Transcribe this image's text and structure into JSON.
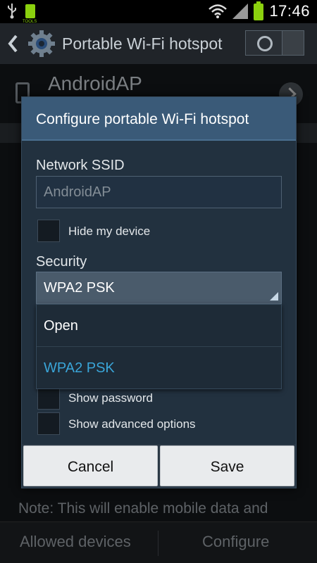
{
  "status_bar": {
    "time": "17:46",
    "icons": [
      "usb-icon",
      "tools-icon",
      "wifi-icon",
      "signal-icon",
      "battery-icon"
    ],
    "tools_label": "TOOLS"
  },
  "action_bar": {
    "title": "Portable Wi-Fi hotspot",
    "toggle_on": false
  },
  "background": {
    "ap_name": "AndroidAP",
    "note": "Note: This will enable mobile data and",
    "bottom_buttons": [
      "Allowed devices",
      "Configure"
    ]
  },
  "dialog": {
    "title": "Configure portable Wi-Fi hotspot",
    "ssid_label": "Network SSID",
    "ssid_value": "AndroidAP",
    "hide_device_label": "Hide my device",
    "security_label": "Security",
    "security_value": "WPA2 PSK",
    "security_options": [
      "Open",
      "WPA2 PSK"
    ],
    "selected_option": "WPA2 PSK",
    "show_password_label": "Show password",
    "show_advanced_label": "Show advanced options",
    "cancel_label": "Cancel",
    "save_label": "Save"
  },
  "colors": {
    "accent": "#3aa5d8",
    "battery": "#8bd10e",
    "dialog_header": "#3a5a78"
  }
}
